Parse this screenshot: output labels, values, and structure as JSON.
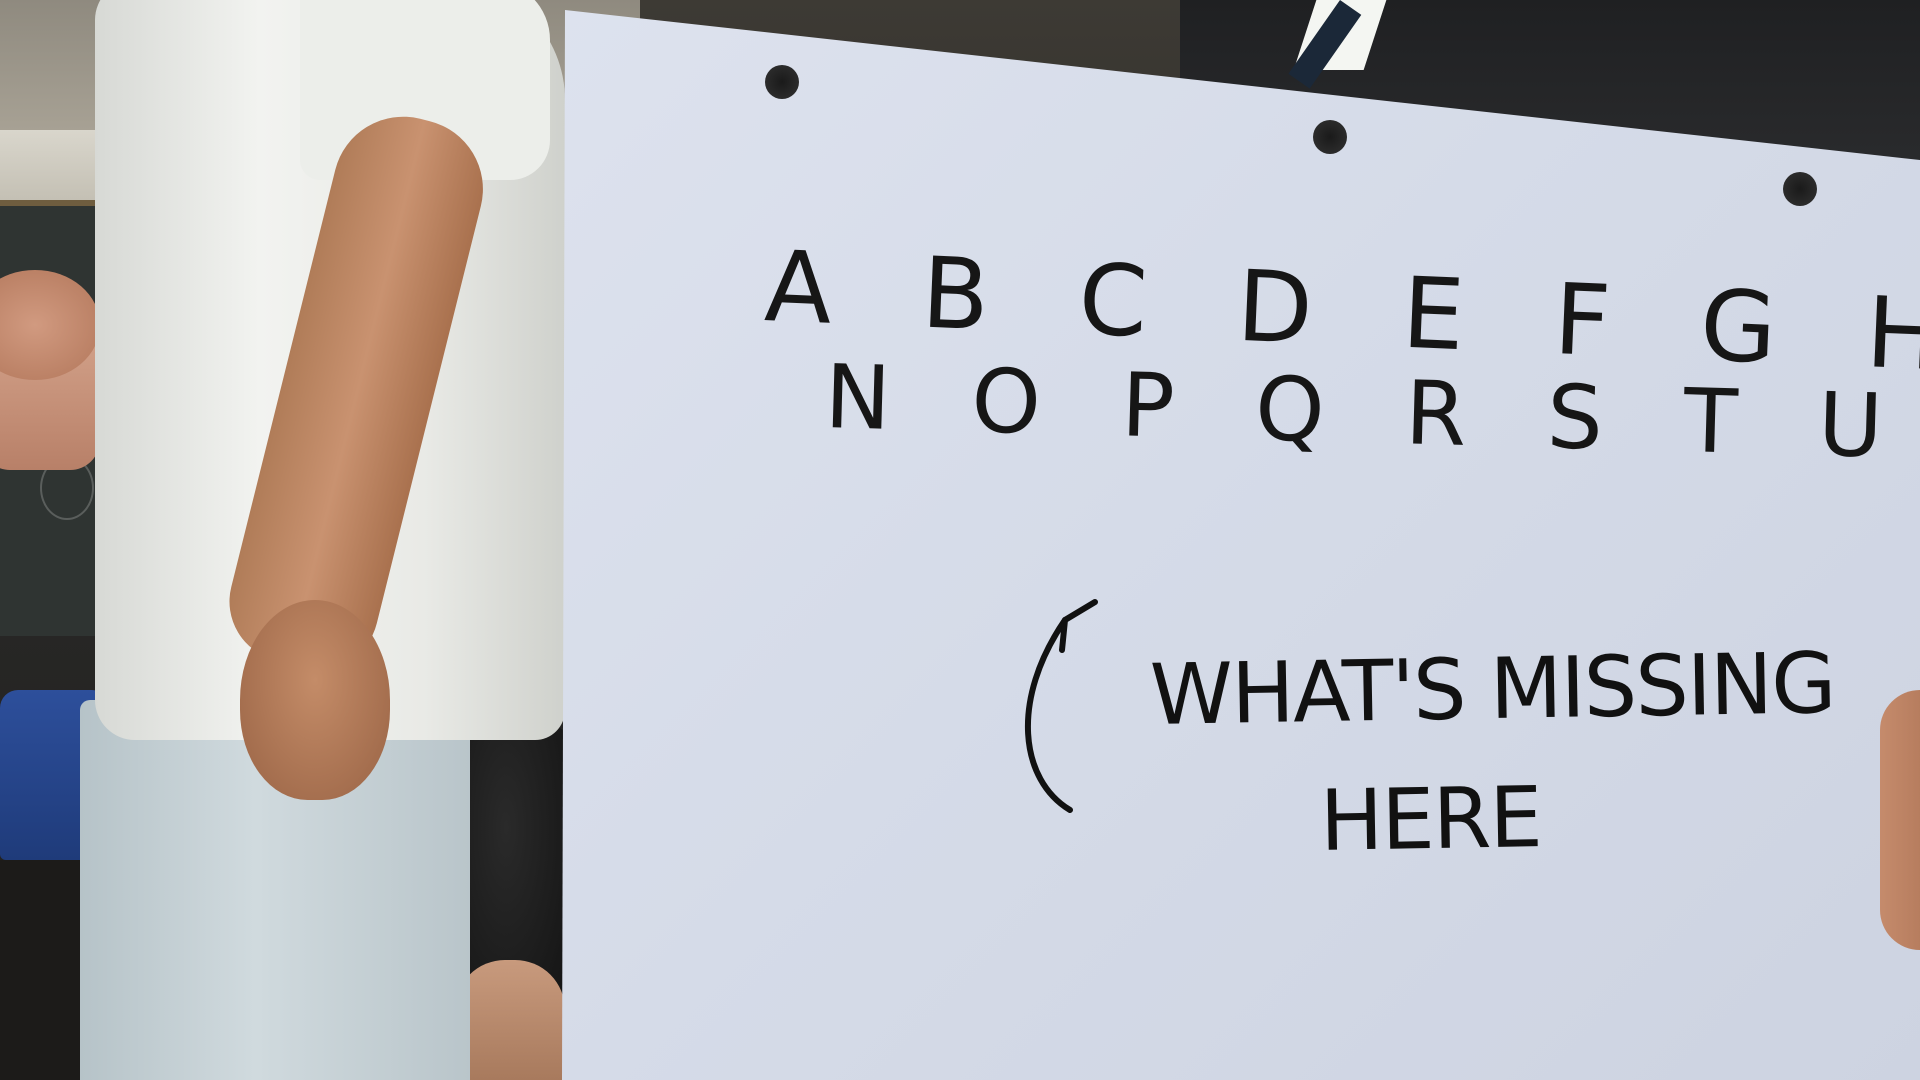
{
  "scene": {
    "description_type": "photo of a hand-held sign in a classroom",
    "sign": {
      "alphabet_row_1": "A B C D E F G H I J K L M",
      "alphabet_row_2": "N O P Q R S T U V W X  Z",
      "question_line_1": "WHAT'S MISSING",
      "question_line_2": "HERE"
    },
    "colors": {
      "paper": "#d5dbe8",
      "ink": "#161616",
      "shirt": "#eceeea",
      "jeans": "#c4d0d5"
    },
    "icons": [
      "curved-arrow-icon"
    ]
  }
}
